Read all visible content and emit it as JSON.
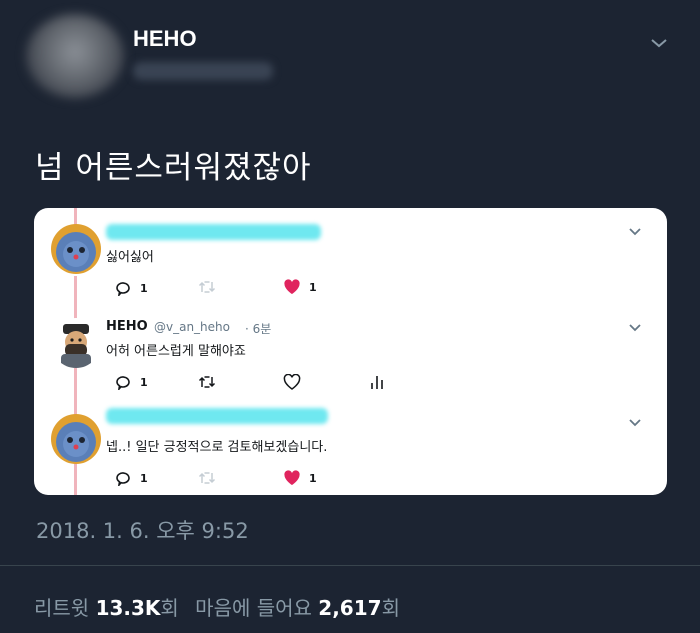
{
  "tweet": {
    "author_name": "HEHO",
    "text": "넘 어른스러워졌잖아",
    "timestamp": "2018. 1. 6. 오후 9:52",
    "stats": {
      "retweet_label": "리트윗",
      "retweet_count": "13.3K",
      "retweet_unit": "회",
      "like_label": "마음에 들어요",
      "like_count": "2,617",
      "like_unit": "회"
    }
  },
  "embedded": {
    "replies": [
      {
        "text": "싫어싫어",
        "reply_count": "1",
        "like_count": "1",
        "liked": true
      },
      {
        "name": "HEHO",
        "handle": "@v_an_heho",
        "time": "· 6분",
        "text": "어허 어른스럽게 말해야죠",
        "reply_count": "1",
        "liked": false
      },
      {
        "text": "넵..! 일단 긍정적으로 검토해보겠습니다.",
        "reply_count": "1",
        "like_count": "1",
        "liked": true
      }
    ]
  },
  "colors": {
    "background": "#1c2432",
    "like_red": "#e0245e",
    "muted": "#8899a6",
    "thread_line": "#f0b4bc",
    "redaction_cyan": "#6fe8f0"
  },
  "icons": [
    "chevron-down-icon",
    "reply-icon",
    "retweet-icon",
    "heart-icon",
    "analytics-icon"
  ]
}
